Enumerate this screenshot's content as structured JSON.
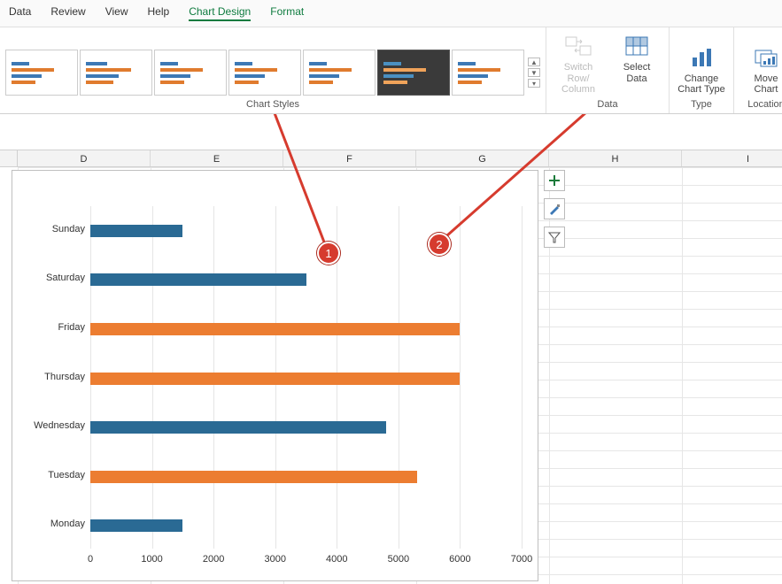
{
  "menu": {
    "data": "Data",
    "review": "Review",
    "view": "View",
    "help": "Help",
    "chartdesign": "Chart Design",
    "format": "Format"
  },
  "ribbon_groups": {
    "styles": "Chart Styles",
    "data": "Data",
    "type": "Type",
    "location": "Location"
  },
  "buttons": {
    "switch": "Switch Row/\nColumn",
    "select": "Select\nData",
    "changetype": "Change\nChart Type",
    "movechart": "Move\nChart"
  },
  "columns": [
    "D",
    "E",
    "F",
    "G",
    "H",
    "I"
  ],
  "callouts": {
    "one": "1",
    "two": "2"
  },
  "chart_data": {
    "type": "bar",
    "orientation": "horizontal",
    "categories": [
      "Sunday",
      "Saturday",
      "Friday",
      "Thursday",
      "Wednesday",
      "Tuesday",
      "Monday"
    ],
    "values": [
      1500,
      3500,
      6000,
      6000,
      4800,
      5300,
      1500
    ],
    "series_colors": [
      "blue",
      "blue",
      "orange",
      "orange",
      "blue",
      "orange",
      "blue"
    ],
    "xlabel": "",
    "ylabel": "",
    "x_ticks": [
      0,
      1000,
      2000,
      3000,
      4000,
      5000,
      6000,
      7000
    ],
    "xlim": [
      0,
      7000
    ]
  }
}
